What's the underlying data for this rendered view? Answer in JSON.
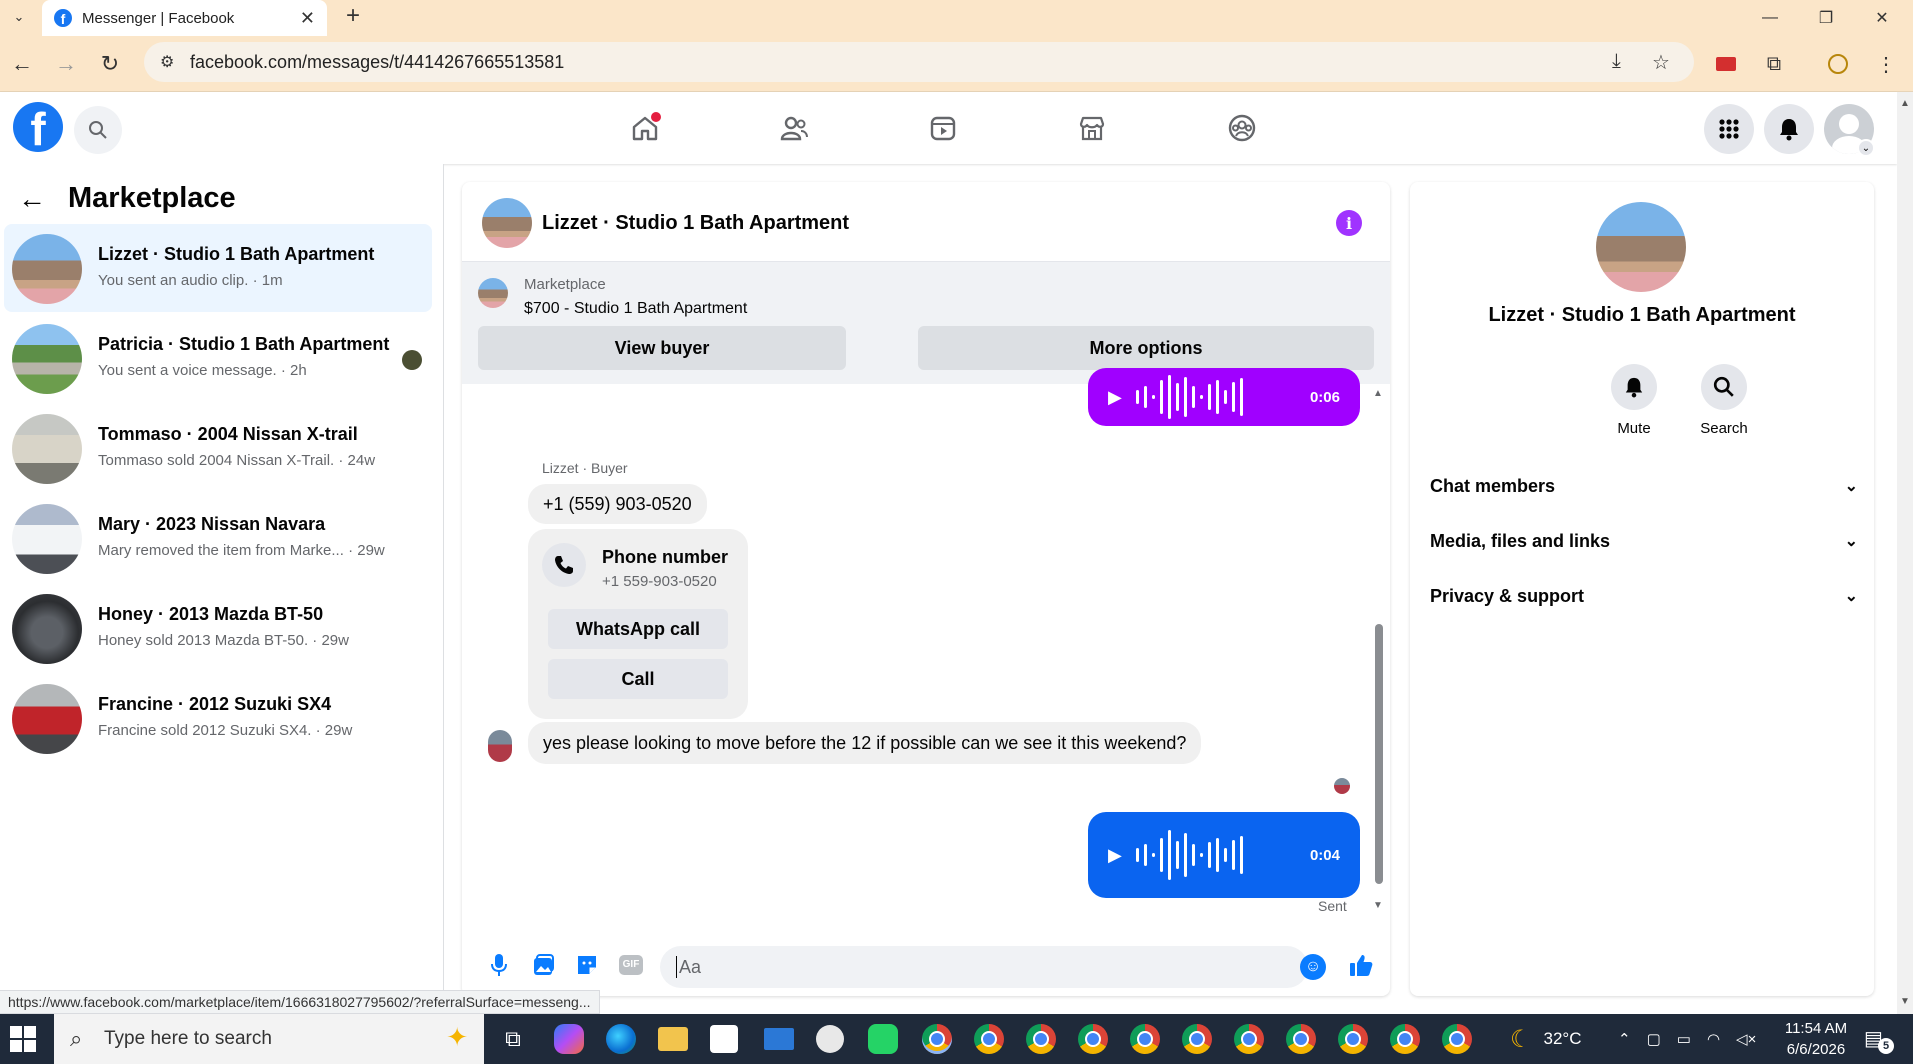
{
  "browser": {
    "tab_title": "Messenger | Facebook",
    "url": "facebook.com/messages/t/4414267665513581",
    "status_url": "https://www.facebook.com/marketplace/item/1666318027795602/?referralSurface=messeng..."
  },
  "left_panel": {
    "title": "Marketplace",
    "conversations": [
      {
        "title": "Lizzet · Studio 1 Bath Apartment",
        "subtitle": "You sent an audio clip. · 1m"
      },
      {
        "title": "Patricia · Studio 1 Bath Apartment",
        "subtitle": "You sent a voice message. · 2h"
      },
      {
        "title": "Tommaso · 2004 Nissan X-trail",
        "subtitle": "Tommaso sold 2004 Nissan X-Trail. · 24w"
      },
      {
        "title": "Mary · 2023 Nissan Navara",
        "subtitle": "Mary removed the item from Marke... · 29w"
      },
      {
        "title": "Honey · 2013 Mazda BT-50",
        "subtitle": "Honey sold 2013 Mazda BT-50. · 29w"
      },
      {
        "title": "Francine · 2012 Suzuki SX4",
        "subtitle": "Francine sold 2012 Suzuki SX4. · 29w"
      }
    ]
  },
  "chat": {
    "title": "Lizzet · Studio 1 Bath Apartment",
    "listing": {
      "label": "Marketplace",
      "price_title": "$700 - Studio 1 Bath Apartment",
      "view_buyer": "View buyer",
      "more_options": "More options"
    },
    "messages": {
      "voice_top_duration": "0:06",
      "sender_label": "Lizzet · Buyer",
      "phone_text": "+1 (559) 903-0520",
      "phone_card_title": "Phone number",
      "phone_card_number": "+1 559-903-0520",
      "whatsapp_call": "WhatsApp call",
      "call": "Call",
      "text_message": "yes please looking to move before the 12 if possible can we see it this weekend?",
      "voice_bottom_duration": "0:04",
      "sent_label": "Sent"
    },
    "composer": {
      "placeholder": "Aa"
    },
    "colors": {
      "voice_top": "#a000ff",
      "voice_bottom": "#0a64f0",
      "info_icon": "#a033ff"
    }
  },
  "right_panel": {
    "title": "Lizzet · Studio 1 Bath Apartment",
    "mute_label": "Mute",
    "search_label": "Search",
    "sections": [
      "Chat members",
      "Media, files and links",
      "Privacy & support"
    ]
  },
  "taskbar": {
    "search_placeholder": "Type here to search",
    "temperature": "32°C",
    "time": "11:54 AM",
    "date": "6/6/2026",
    "notification_count": "5"
  }
}
